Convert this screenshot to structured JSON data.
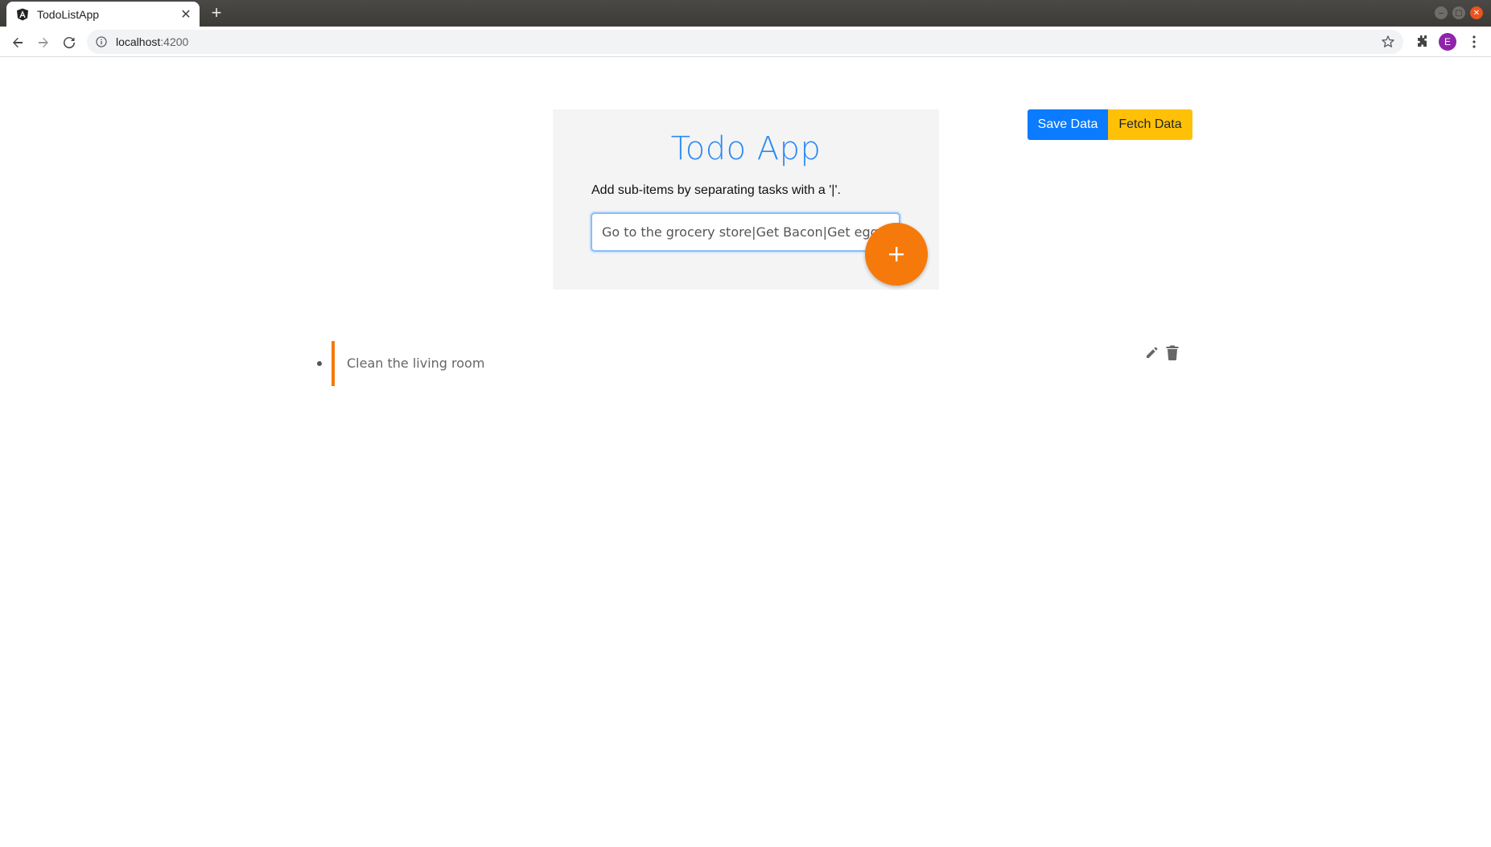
{
  "browser": {
    "tab_title": "TodoListApp",
    "url_host": "localhost",
    "url_port": ":4200",
    "profile_initial": "E"
  },
  "app": {
    "title": "Todo App",
    "hint": "Add sub-items by separating tasks with a '|'.",
    "input_value": "Go to the grocery store|Get Bacon|Get eggs|Get p",
    "add_button_label": "+",
    "save_label": "Save Data",
    "fetch_label": "Fetch Data",
    "accent_color": "#f57a0b",
    "primary_color": "#0b7bff",
    "warning_color": "#ffc107"
  },
  "todos": [
    {
      "text": "Clean the living room"
    }
  ]
}
